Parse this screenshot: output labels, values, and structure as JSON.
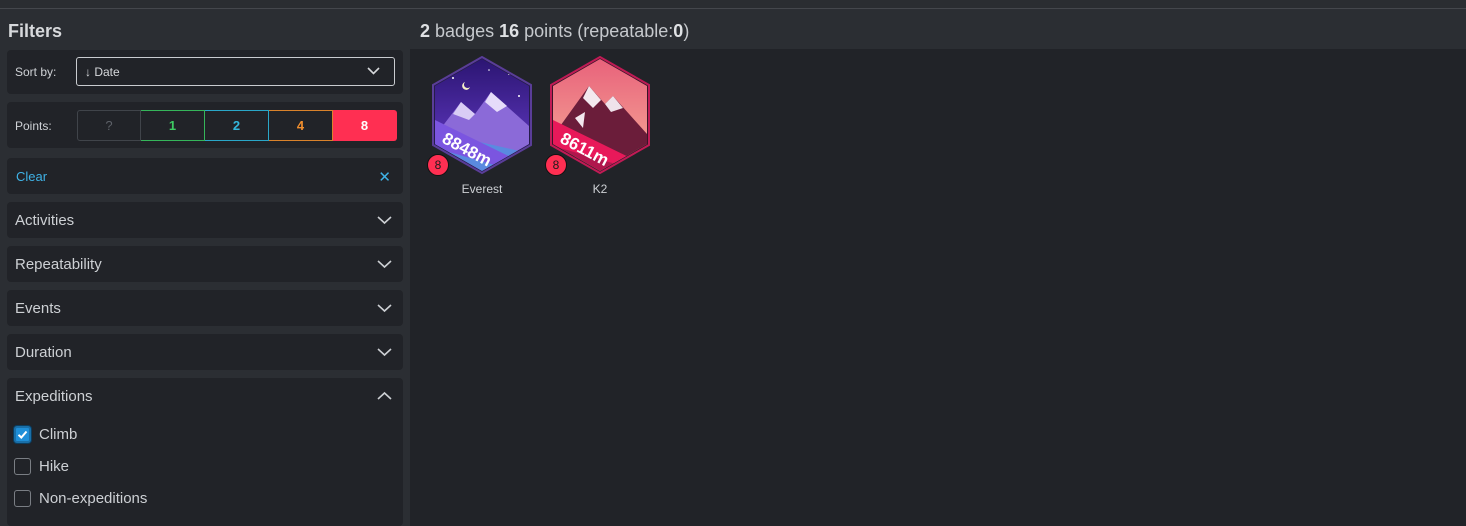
{
  "sidebar": {
    "title": "Filters",
    "sort": {
      "label": "Sort by:",
      "value": "↓ Date"
    },
    "points": {
      "label": "Points:",
      "options": [
        "?",
        "1",
        "2",
        "4",
        "8"
      ],
      "selected": "8"
    },
    "clear": {
      "label": "Clear",
      "icon": "close-icon"
    },
    "accordions": [
      {
        "label": "Activities",
        "expanded": false
      },
      {
        "label": "Repeatability",
        "expanded": false
      },
      {
        "label": "Events",
        "expanded": false
      },
      {
        "label": "Duration",
        "expanded": false
      },
      {
        "label": "Expeditions",
        "expanded": true
      }
    ],
    "expeditions": [
      {
        "label": "Climb",
        "checked": true
      },
      {
        "label": "Hike",
        "checked": false
      },
      {
        "label": "Non-expeditions",
        "checked": false
      }
    ]
  },
  "summary": {
    "badges_count": "2",
    "badges_word": "badges",
    "points_count": "16",
    "points_word": "points",
    "repeatable_prefix": "(repeatable:",
    "repeatable_count": "0",
    "repeatable_suffix": ")"
  },
  "badges": [
    {
      "name": "Everest",
      "ribbon": "8848m",
      "points": "8",
      "colors": {
        "border": "#5a3d98",
        "sky": "#3b1e8c",
        "ribbon": "#7b55e0"
      }
    },
    {
      "name": "K2",
      "ribbon": "8611m",
      "points": "8",
      "colors": {
        "border": "#c01b55",
        "sky": "#f4907a",
        "ribbon": "#e8195a"
      }
    }
  ],
  "colors": {
    "accent_blue": "#3fb2e6",
    "points_red": "#ff2f52",
    "points_green": "#3ecb63",
    "points_cyan": "#33b6dc",
    "points_orange": "#f08e2d"
  }
}
